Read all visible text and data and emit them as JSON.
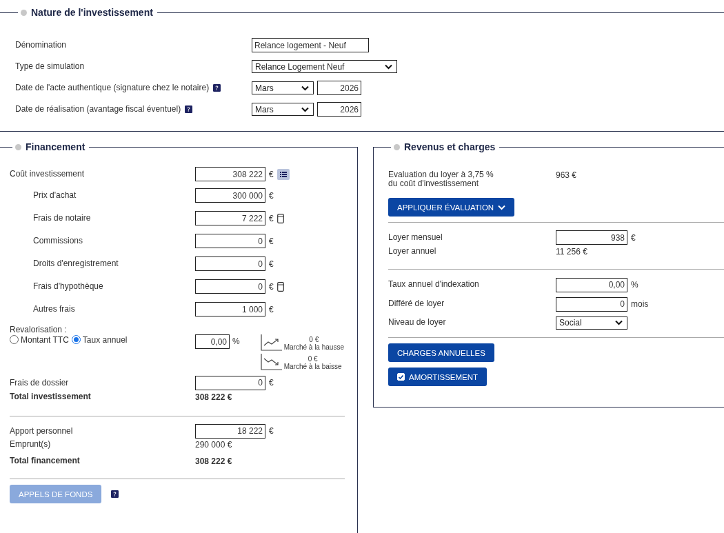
{
  "nature": {
    "title": "Nature de l'investissement",
    "rows": [
      {
        "kind": "text",
        "label": "Dénomination",
        "help": false,
        "value": "Relance logement - Neuf"
      },
      {
        "kind": "select",
        "label": "Type de simulation",
        "help": false,
        "value": "Relance Logement Neuf"
      },
      {
        "kind": "date",
        "label": "Date de l'acte authentique (signature chez le notaire)",
        "help": true,
        "month": "Mars",
        "year": "2026"
      },
      {
        "kind": "date",
        "label": "Date de réalisation (avantage fiscal éventuel)",
        "help": true,
        "month": "Mars",
        "year": "2026"
      }
    ]
  },
  "financement": {
    "title": "Financement",
    "rows": [
      {
        "kind": "listinput",
        "label": "Coût investissement",
        "indent": false,
        "value": "308 222",
        "unit": "€"
      },
      {
        "kind": "input",
        "label": "Prix d'achat",
        "indent": true,
        "value": "300 000",
        "unit": "€"
      },
      {
        "kind": "calcinput",
        "label": "Frais de notaire",
        "indent": true,
        "value": "7 222",
        "unit": "€"
      },
      {
        "kind": "input",
        "label": "Commissions",
        "indent": true,
        "value": "0",
        "unit": "€"
      },
      {
        "kind": "input",
        "label": "Droits d'enregistrement",
        "indent": true,
        "value": "0",
        "unit": "€"
      },
      {
        "kind": "calcinput",
        "label": "Frais d'hypothèque",
        "indent": true,
        "value": "0",
        "unit": "€"
      },
      {
        "kind": "input",
        "label": "Autres frais",
        "indent": true,
        "value": "1 000",
        "unit": "€"
      },
      {
        "kind": "revalorisation",
        "label": "Revalorisation :",
        "options": [
          {
            "label": "Montant TTC",
            "selected": false
          },
          {
            "label": "Taux annuel",
            "selected": true
          }
        ],
        "value": "0,00",
        "unit": "%",
        "markets": [
          {
            "kind": "up",
            "amount": "0 €",
            "label": "Marché à la hausse"
          },
          {
            "kind": "down",
            "amount": "0 €",
            "label": "Marché à la baisse"
          }
        ]
      },
      {
        "kind": "input",
        "label": "Frais de dossier",
        "indent": false,
        "value": "0",
        "unit": "€"
      },
      {
        "kind": "static",
        "label": "Total investissement",
        "bold": true,
        "value": "308 222 €"
      },
      {
        "kind": "divider"
      },
      {
        "kind": "input",
        "label": "Apport personnel",
        "indent": false,
        "value": "18 222",
        "unit": "€"
      },
      {
        "kind": "static",
        "label": "Emprunt(s)",
        "bold": false,
        "value": "290 000 €"
      },
      {
        "kind": "static",
        "label": "Total financement",
        "bold": true,
        "value": "308 222 €"
      },
      {
        "kind": "divider"
      },
      {
        "kind": "button",
        "label": "APPELS DE FONDS",
        "disabled": true,
        "help": true
      }
    ]
  },
  "revenus": {
    "title": "Revenus et charges",
    "rows": [
      {
        "kind": "static",
        "label": "Evaluation du loyer à 3,75 %\ndu coût d'investissement",
        "bold": false,
        "value": "963 €"
      },
      {
        "kind": "button",
        "label": "APPLIQUER ÉVALUATION",
        "disabled": false,
        "dropdown": true
      },
      {
        "kind": "divider"
      },
      {
        "kind": "input",
        "label": "Loyer mensuel",
        "value": "938",
        "unit": "€"
      },
      {
        "kind": "static",
        "label": "Loyer annuel",
        "bold": false,
        "value": "11 256 €"
      },
      {
        "kind": "divider"
      },
      {
        "kind": "input",
        "label": "Taux annuel d'indexation",
        "value": "0,00",
        "unit": "%"
      },
      {
        "kind": "input",
        "label": "Différé de loyer",
        "value": "0",
        "unit": "mois"
      },
      {
        "kind": "select",
        "label": "Niveau de loyer",
        "value": "Social"
      },
      {
        "kind": "divider"
      },
      {
        "kind": "button",
        "label": "CHARGES ANNUELLES",
        "disabled": false
      },
      {
        "kind": "button",
        "label": "AMORTISSEMENT",
        "disabled": false,
        "checked": true
      }
    ]
  }
}
